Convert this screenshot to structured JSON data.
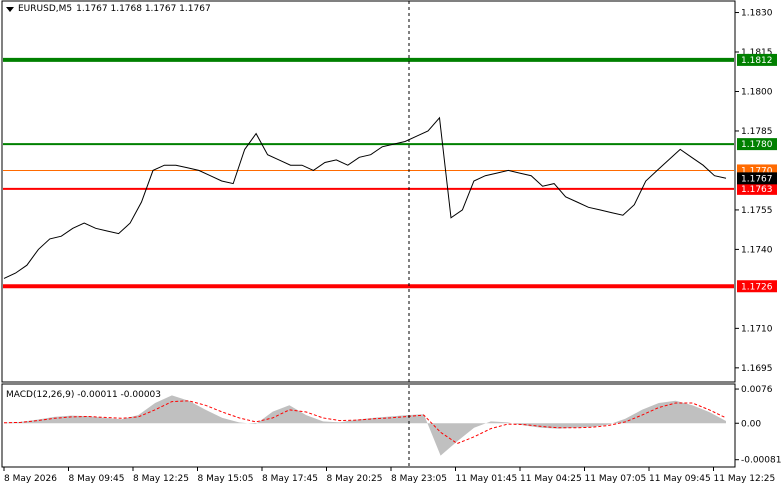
{
  "header": {
    "menu_icon": "triangle-down-icon",
    "symbol": "EURUSD,M5",
    "ohlc": "1.1767 1.1768 1.1767 1.1767"
  },
  "price_axis": {
    "ticks": [
      "1.1830",
      "1.1815",
      "1.1800",
      "1.1785",
      "1.1770",
      "1.1755",
      "1.1740",
      "1.1725",
      "1.1710",
      "1.1695"
    ],
    "tick_values": [
      1.183,
      1.1815,
      1.18,
      1.1785,
      1.177,
      1.1755,
      1.174,
      1.1725,
      1.171,
      1.1695
    ],
    "visible_ticks": [
      "1.1830",
      "1.1815",
      "1.1800",
      "1.1785",
      "1.1755",
      "1.1740",
      "1.1710",
      "1.1695"
    ]
  },
  "levels": [
    {
      "label": "1.1812",
      "value": 1.1812,
      "color": "#008000",
      "thick": true
    },
    {
      "label": "1.1780",
      "value": 1.178,
      "color": "#008000",
      "thick": false
    },
    {
      "label": "1.1770",
      "value": 1.177,
      "color": "#ff6a00",
      "thick": false,
      "thin": true
    },
    {
      "label": "1.1763",
      "value": 1.1763,
      "color": "#ff0000",
      "thick": false
    },
    {
      "label": "1.1726",
      "value": 1.1726,
      "color": "#ff0000",
      "thick": true
    }
  ],
  "current_price": {
    "label": "1.1767",
    "value": 1.1767
  },
  "time_axis": [
    "8 May 2026",
    "8 May 09:45",
    "8 May 12:25",
    "8 May 15:05",
    "8 May 17:45",
    "8 May 20:25",
    "8 May 23:05",
    "11 May 01:45",
    "11 May 04:25",
    "11 May 07:05",
    "11 May 09:45",
    "11 May 12:25"
  ],
  "macd": {
    "title": "MACD(12,26,9) -0.00011 -0.00003",
    "ticks": [
      "0.0076",
      "0.00",
      "-0.00081"
    ],
    "tick_values": [
      0.00076,
      0.0,
      -0.00081
    ]
  },
  "chart_data": {
    "type": "line",
    "title": "EURUSD,M5",
    "price_series": [
      1.1729,
      1.1731,
      1.1734,
      1.174,
      1.1744,
      1.1745,
      1.1748,
      1.175,
      1.1748,
      1.1747,
      1.1746,
      1.175,
      1.1758,
      1.177,
      1.1772,
      1.1772,
      1.1771,
      1.177,
      1.1768,
      1.1766,
      1.1765,
      1.1778,
      1.1784,
      1.1776,
      1.1774,
      1.1772,
      1.1772,
      1.177,
      1.1773,
      1.1774,
      1.1772,
      1.1775,
      1.1776,
      1.1779,
      1.178,
      1.1781,
      1.1783,
      1.1785,
      1.179,
      1.1752,
      1.1755,
      1.1766,
      1.1768,
      1.1769,
      1.177,
      1.1769,
      1.1768,
      1.1764,
      1.1765,
      1.176,
      1.1758,
      1.1756,
      1.1755,
      1.1754,
      1.1753,
      1.1757,
      1.1766,
      1.177,
      1.1774,
      1.1778,
      1.1775,
      1.1772,
      1.1768,
      1.1767
    ],
    "macd_hist": [
      1e-05,
      3e-05,
      8e-05,
      0.00014,
      0.00017,
      0.00016,
      0.00012,
      9e-05,
      0.00018,
      0.00045,
      0.00062,
      0.0005,
      0.0003,
      0.00012,
      2e-05,
      -2e-05,
      0.00026,
      0.0004,
      0.00018,
      4e-05,
      2e-05,
      8e-05,
      0.00012,
      0.00015,
      0.00018,
      0.0002,
      -0.00072,
      -0.0004,
      -0.0001,
      4e-05,
      2e-05,
      -5e-05,
      -0.0001,
      -0.00012,
      -0.0001,
      -8e-05,
      -3e-05,
      0.0001,
      0.0003,
      0.00045,
      0.0005,
      0.0004,
      0.00025,
      5e-05
    ],
    "macd_signal": [
      1e-05,
      2e-05,
      6e-05,
      0.00011,
      0.00014,
      0.00015,
      0.00013,
      0.00011,
      0.00014,
      0.0003,
      0.00048,
      0.0005,
      0.0004,
      0.00025,
      0.00012,
      3e-05,
      0.00012,
      0.0003,
      0.00025,
      0.00012,
      6e-05,
      7e-05,
      0.0001,
      0.00012,
      0.00015,
      0.00018,
      -0.0002,
      -0.00045,
      -0.0003,
      -0.00012,
      -2e-05,
      -3e-05,
      -7e-05,
      -0.0001,
      -0.0001,
      -9e-05,
      -5e-05,
      3e-05,
      0.00018,
      0.00035,
      0.00045,
      0.00045,
      0.0003,
      0.00012
    ],
    "ylim": [
      1.169,
      1.1834
    ],
    "macd_ylim": [
      -0.00095,
      0.00085
    ]
  }
}
